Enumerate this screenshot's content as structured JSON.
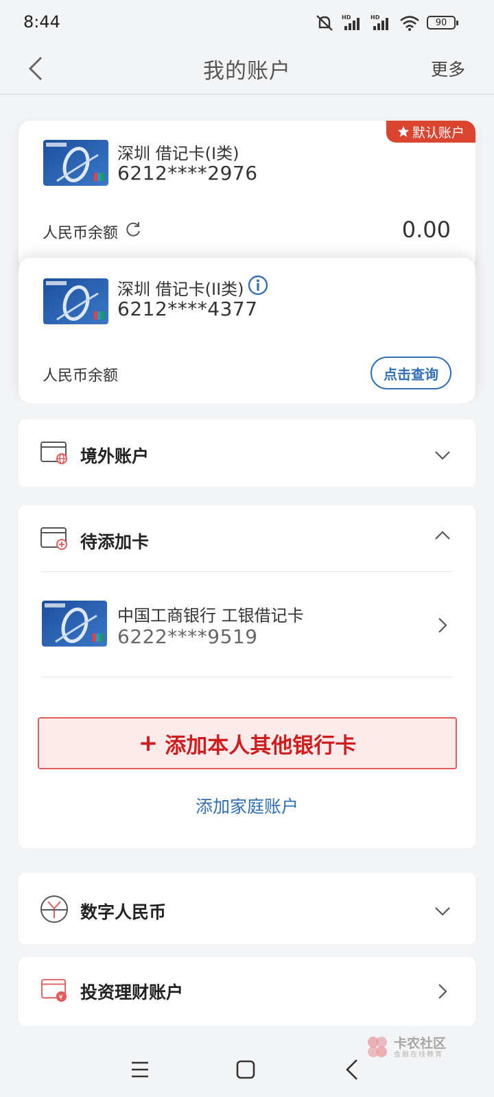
{
  "status_bar": {
    "time": "8:44",
    "battery": "90"
  },
  "nav": {
    "title": "我的账户",
    "more": "更多"
  },
  "cards": [
    {
      "name": "深圳 借记卡(I类)",
      "number": "6212****2976",
      "balance_label": "人民币余额",
      "balance": "0.00",
      "badge": "默认账户"
    },
    {
      "name": "深圳 借记卡(II类)",
      "number": "6212****4377",
      "balance_label": "人民币余额",
      "query_label": "点击查询"
    }
  ],
  "sections": {
    "overseas": {
      "title": "境外账户"
    },
    "pending": {
      "title": "待添加卡",
      "card": {
        "name": "中国工商银行 工银借记卡",
        "number": "6222****9519"
      },
      "add_card": "添加本人其他银行卡",
      "add_family": "添加家庭账户"
    },
    "digital": {
      "title": "数字人民币"
    },
    "invest": {
      "title": "投资理财账户"
    }
  },
  "watermark": {
    "text": "卡农社区",
    "sub": "金融在线教育"
  },
  "colors": {
    "accent_blue": "#2f6fb8",
    "accent_red": "#cf1d1d",
    "badge_red": "#d9452f"
  }
}
